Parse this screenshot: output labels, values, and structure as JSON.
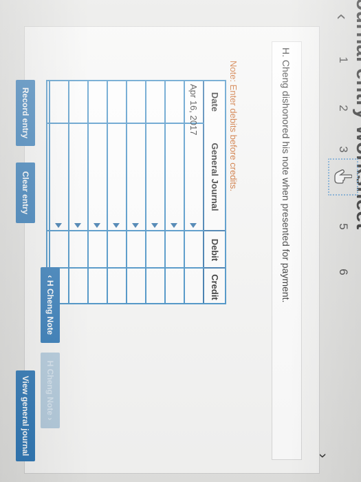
{
  "title": "Journal entry worksheet",
  "nav": {
    "prev_glyph": "‹",
    "next_glyph": "›",
    "tabs": [
      "1",
      "2",
      "3",
      "4",
      "5",
      "6"
    ],
    "current_tab_icon": "hand-pointer-icon"
  },
  "prompt": "H. Cheng dishonored his note when presented for payment.",
  "note": "Note: Enter debits before credits.",
  "journal": {
    "columns": [
      "Date",
      "General Journal",
      "Debit",
      "Credit"
    ],
    "rows": [
      {
        "date": "Apr 16, 2017",
        "account": "",
        "debit": "",
        "credit": ""
      },
      {
        "date": "",
        "account": "",
        "debit": "",
        "credit": ""
      },
      {
        "date": "",
        "account": "",
        "debit": "",
        "credit": ""
      },
      {
        "date": "",
        "account": "",
        "debit": "",
        "credit": ""
      },
      {
        "date": "",
        "account": "",
        "debit": "",
        "credit": ""
      },
      {
        "date": "",
        "account": "",
        "debit": "",
        "credit": ""
      },
      {
        "date": "",
        "account": "",
        "debit": "",
        "credit": ""
      },
      {
        "date": "",
        "account": "",
        "debit": "",
        "credit": ""
      }
    ]
  },
  "buttons": {
    "record": "Record entry",
    "clear": "Clear entry",
    "view": "View general journal"
  },
  "bottom_nav": {
    "back": "‹ H Cheng Note",
    "next": "H Cheng Note ›"
  },
  "colors": {
    "accent": "#2f79b8",
    "note": "#c75d18",
    "disabled": "#b5cddf"
  }
}
